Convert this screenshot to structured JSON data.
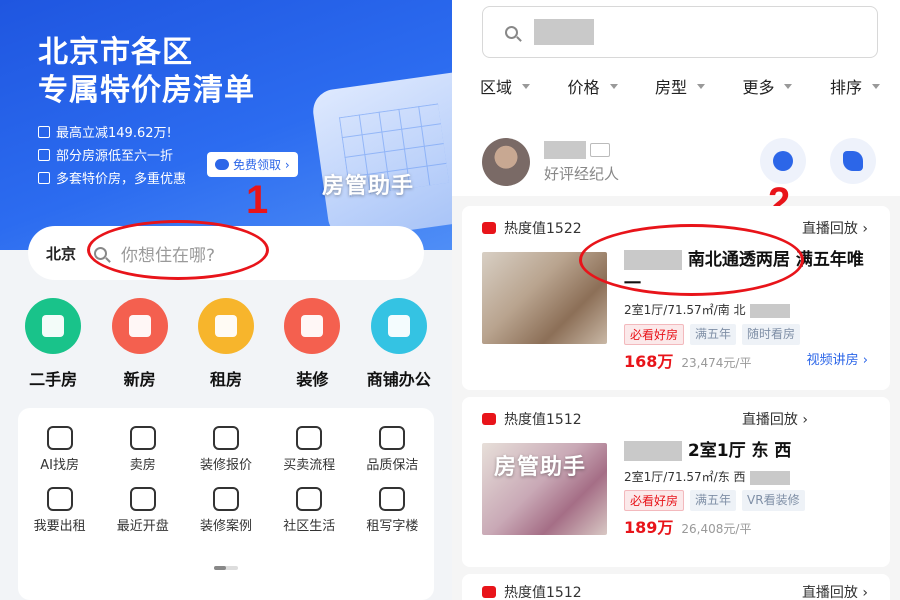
{
  "left": {
    "banner": {
      "title_line1": "北京市各区",
      "title_line2": "专属特价房清单",
      "perks": [
        "最高立减149.62万!",
        "部分房源低至六一折",
        "多套特价房，多重优惠"
      ],
      "coupon_button": "免费领取 ›",
      "watermark": "房管助手",
      "annotation_number": "1"
    },
    "search": {
      "city": "北京",
      "placeholder": "你想住在哪?"
    },
    "main_categories": [
      {
        "label": "二手房",
        "color": "#19c38a"
      },
      {
        "label": "新房",
        "color": "#f4604f"
      },
      {
        "label": "租房",
        "color": "#f7b52c"
      },
      {
        "label": "装修",
        "color": "#f4604f"
      },
      {
        "label": "商铺办公",
        "color": "#34c3e3"
      }
    ],
    "tools": [
      "AI找房",
      "卖房",
      "装修报价",
      "买卖流程",
      "品质保洁",
      "我要出租",
      "最近开盘",
      "装修案例",
      "社区生活",
      "租写字楼"
    ]
  },
  "right": {
    "filters": [
      "区域",
      "价格",
      "房型",
      "更多",
      "排序"
    ],
    "agent": {
      "subtitle": "好评经纪人"
    },
    "annotation_number": "2",
    "listings": [
      {
        "heat": "热度值1522",
        "replay": "直播回放 ›",
        "title": "南北通透两居 满五年唯一",
        "meta": "2室1厅/71.57㎡/南 北",
        "tags": [
          "必看好房",
          "满五年",
          "随时看房"
        ],
        "price": "168万",
        "unit_price": "23,474元/平",
        "video": "视频讲房 ›"
      },
      {
        "heat": "热度值1512",
        "replay": "直播回放 ›",
        "title": "2室1厅 东 西",
        "meta": "2室1厅/71.57㎡/东 西",
        "tags": [
          "必看好房",
          "满五年",
          "VR看装修"
        ],
        "price": "189万",
        "unit_price": "26,408元/平",
        "watermark": "房管助手"
      },
      {
        "heat": "热度值1512",
        "replay": "直播回放 ›"
      }
    ]
  },
  "colors": {
    "accent_blue": "#2c66e8",
    "annotation_red": "#e8141a"
  }
}
